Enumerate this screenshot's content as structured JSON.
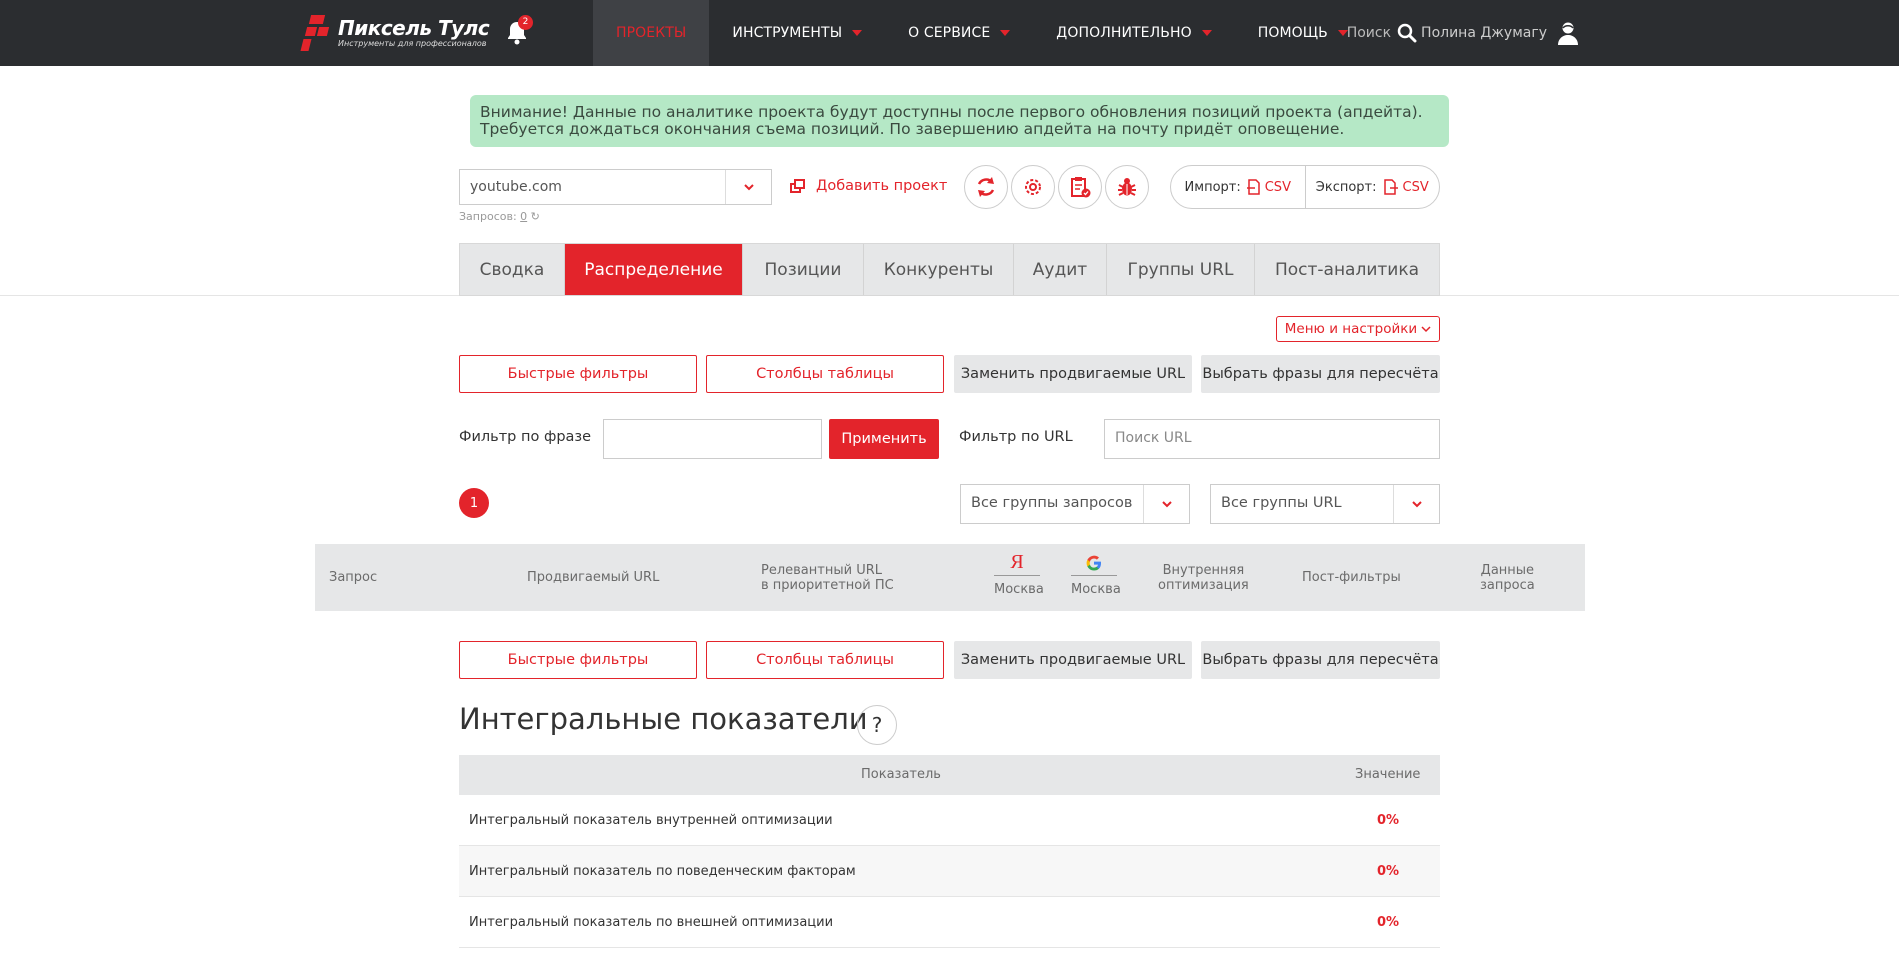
{
  "brand": {
    "title": "Пиксель Тулс",
    "subtitle": "Инструменты для профессионалов",
    "accent": "#e3242b",
    "navbar_bg": "#2b2d30"
  },
  "notifications": {
    "count": "2"
  },
  "nav": [
    {
      "label": "ПРОЕКТЫ",
      "active": true,
      "caret": false
    },
    {
      "label": "ИНСТРУМЕНТЫ",
      "active": false,
      "caret": true
    },
    {
      "label": "О СЕРВИСЕ",
      "active": false,
      "caret": true
    },
    {
      "label": "ДОПОЛНИТЕЛЬНО",
      "active": false,
      "caret": true
    },
    {
      "label": "ПОМОЩЬ",
      "active": false,
      "caret": true
    }
  ],
  "top_right": {
    "search_label": "Поиск",
    "user_name": "Полина Джумагу"
  },
  "alert": {
    "line1": "Внимание! Данные по аналитике проекта будут доступны после первого обновления позиций проекта (апдейта).",
    "line2": "Требуется дождаться окончания съема позиций. По завершению апдейта на почту придёт оповещение."
  },
  "project": {
    "selected": "youtube.com",
    "queries_label": "Запросов:",
    "queries_count": "0",
    "add_label": "Добавить проект"
  },
  "toolbar_icons": [
    "refresh-icon",
    "settings-icon",
    "clipboard-check-icon",
    "bug-icon"
  ],
  "import_export": {
    "import_label": "Импорт:",
    "export_label": "Экспорт:",
    "csv": "CSV"
  },
  "tabs": [
    {
      "label": "Сводка",
      "active": false
    },
    {
      "label": "Распределение",
      "active": true
    },
    {
      "label": "Позиции",
      "active": false
    },
    {
      "label": "Конкуренты",
      "active": false
    },
    {
      "label": "Аудит",
      "active": false
    },
    {
      "label": "Группы URL",
      "active": false
    },
    {
      "label": "Пост-аналитика",
      "active": false
    }
  ],
  "menu_settings": "Меню и настройки",
  "actions": {
    "quick_filters": "Быстрые фильтры",
    "table_columns": "Столбцы таблицы",
    "replace_urls": "Заменить продвигаемые URL",
    "choose_phrases": "Выбрать фразы для пересчёта"
  },
  "filters": {
    "phrase_label": "Фильтр по фразе",
    "phrase_value": "",
    "apply": "Применить",
    "url_label": "Фильтр по URL",
    "url_placeholder": "Поиск URL"
  },
  "pagination": {
    "current": "1"
  },
  "group_selects": {
    "queries": "Все группы запросов",
    "urls": "Все группы URL"
  },
  "table_header": {
    "query": "Запрос",
    "promoted_url": "Продвигаемый URL",
    "relevant_url_1": "Релевантный URL",
    "relevant_url_2": "в приоритетной ПС",
    "yandex_letter": "Я",
    "yandex_region": "Москва",
    "google_letter": "G",
    "google_region": "Москва",
    "internal_1": "Внутренняя",
    "internal_2": "оптимизация",
    "post_filters": "Пост-фильтры",
    "query_data_1": "Данные",
    "query_data_2": "запроса"
  },
  "integral": {
    "title": "Интегральные показатели",
    "help": "?",
    "col_indicator": "Показатель",
    "col_value": "Значение",
    "rows": [
      {
        "name": "Интегральный показатель внутренней оптимизации",
        "value": "0%"
      },
      {
        "name": "Интегральный показатель по поведенческим факторам",
        "value": "0%"
      },
      {
        "name": "Интегральный показатель по внешней оптимизации",
        "value": "0%"
      }
    ]
  }
}
